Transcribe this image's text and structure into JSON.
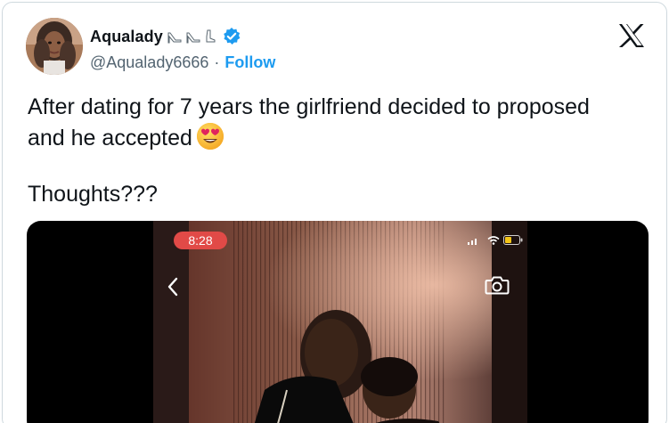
{
  "tweet": {
    "display_name": "Aqualady",
    "handle": "@Aqualady6666",
    "separator": "·",
    "follow_label": "Follow",
    "text_line1": "After dating for 7 years the girlfriend decided to proposed",
    "text_line2": "and he accepted",
    "text_line3": "Thoughts???",
    "emoji_icon": "heart-eyes-emoji-icon"
  },
  "media": {
    "time": "8:28"
  },
  "colors": {
    "follow": "#1d9bf0",
    "verified": "#1d9bf0",
    "handle": "#536471",
    "time_pill": "#e14a47"
  }
}
